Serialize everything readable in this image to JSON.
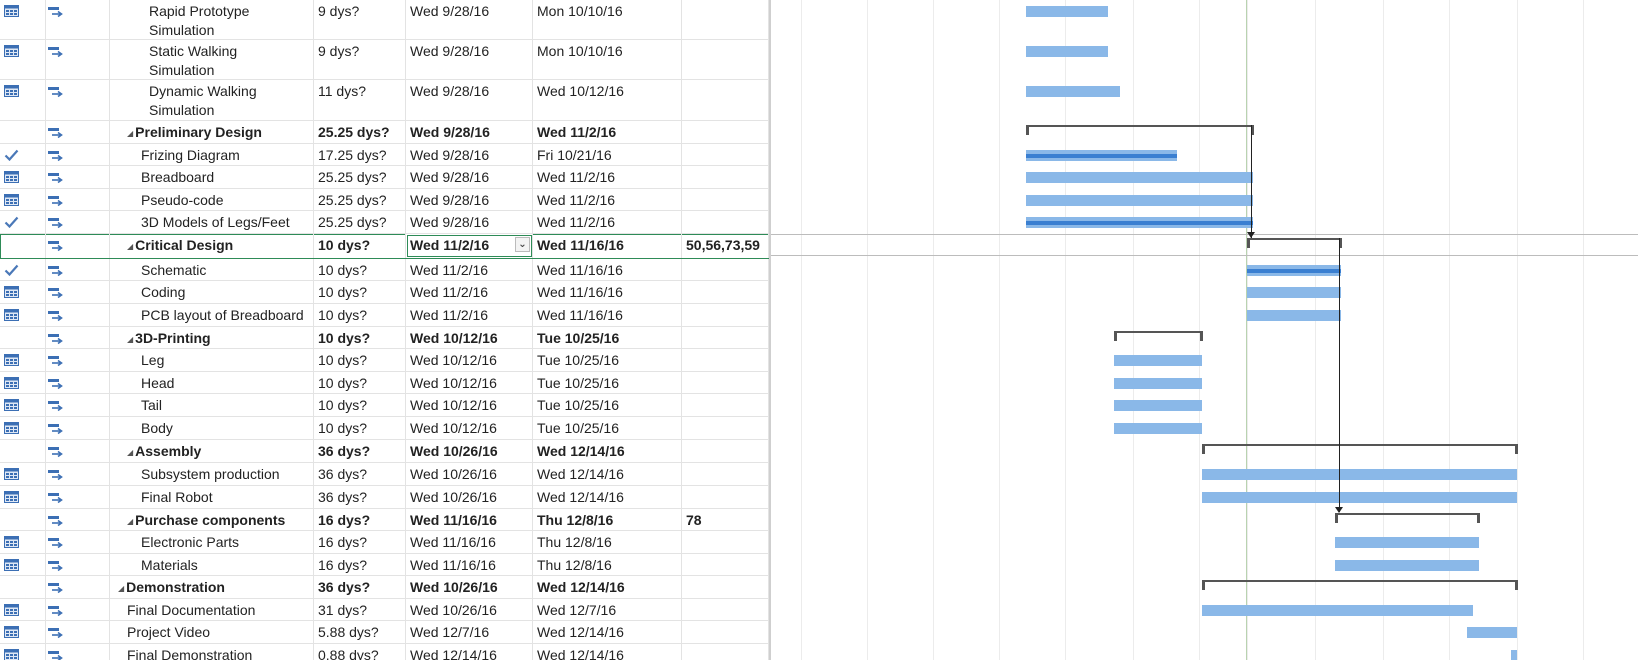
{
  "colors": {
    "bar": "#8ab8e8",
    "progress": "#3a7fd1",
    "summary": "#555555",
    "selection": "#2e8b57",
    "check": "#4a78b8"
  },
  "tasks": [
    {
      "indicator": "calendar-icon",
      "name": "Rapid Prototype",
      "name2": "Simulation",
      "duration": "9 dys?",
      "start": "Wed 9/28/16",
      "finish": "Mon 10/10/16",
      "pred": "",
      "level": 3,
      "bold": false
    },
    {
      "indicator": "calendar-icon",
      "name": "Static Walking",
      "name2": "Simulation",
      "duration": "9 dys?",
      "start": "Wed 9/28/16",
      "finish": "Mon 10/10/16",
      "pred": "",
      "level": 3,
      "bold": false
    },
    {
      "indicator": "calendar-icon",
      "name": "Dynamic Walking",
      "name2": "Simulation",
      "duration": "11 dys?",
      "start": "Wed 9/28/16",
      "finish": "Wed 10/12/16",
      "pred": "",
      "level": 3,
      "bold": false
    },
    {
      "indicator": "",
      "name": "Preliminary Design",
      "name2": "",
      "duration": "25.25 dys?",
      "start": "Wed 9/28/16",
      "finish": "Wed 11/2/16",
      "pred": "",
      "level": 1,
      "bold": true
    },
    {
      "indicator": "check-icon",
      "name": "Frizing Diagram",
      "name2": "",
      "duration": "17.25 dys?",
      "start": "Wed 9/28/16",
      "finish": "Fri 10/21/16",
      "pred": "",
      "level": 2,
      "bold": false
    },
    {
      "indicator": "calendar-icon",
      "name": "Breadboard",
      "name2": "",
      "duration": "25.25 dys?",
      "start": "Wed 9/28/16",
      "finish": "Wed 11/2/16",
      "pred": "",
      "level": 2,
      "bold": false
    },
    {
      "indicator": "calendar-icon",
      "name": "Pseudo-code",
      "name2": "",
      "duration": "25.25 dys?",
      "start": "Wed 9/28/16",
      "finish": "Wed 11/2/16",
      "pred": "",
      "level": 2,
      "bold": false
    },
    {
      "indicator": "check-icon",
      "name": "3D Models of Legs/Feet",
      "name2": "",
      "duration": "25.25 dys?",
      "start": "Wed 9/28/16",
      "finish": "Wed 11/2/16",
      "pred": "",
      "level": 2,
      "bold": false
    },
    {
      "indicator": "",
      "name": "Critical Design",
      "name2": "",
      "duration": "10 dys?",
      "start": "Wed 11/2/16",
      "finish": "Wed 11/16/16",
      "pred": "50,56,73,59",
      "level": 1,
      "bold": true
    },
    {
      "indicator": "check-icon",
      "name": "Schematic",
      "name2": "",
      "duration": "10 dys?",
      "start": "Wed 11/2/16",
      "finish": "Wed 11/16/16",
      "pred": "",
      "level": 2,
      "bold": false
    },
    {
      "indicator": "calendar-icon",
      "name": "Coding",
      "name2": "",
      "duration": "10 dys?",
      "start": "Wed 11/2/16",
      "finish": "Wed 11/16/16",
      "pred": "",
      "level": 2,
      "bold": false
    },
    {
      "indicator": "calendar-icon",
      "name": "PCB layout of Breadboard",
      "name2": "",
      "duration": "10 dys?",
      "start": "Wed 11/2/16",
      "finish": "Wed 11/16/16",
      "pred": "",
      "level": 2,
      "bold": false
    },
    {
      "indicator": "",
      "name": "3D-Printing",
      "name2": "",
      "duration": "10 dys?",
      "start": "Wed 10/12/16",
      "finish": "Tue 10/25/16",
      "pred": "",
      "level": 1,
      "bold": true
    },
    {
      "indicator": "calendar-icon",
      "name": "Leg",
      "name2": "",
      "duration": "10 dys?",
      "start": "Wed 10/12/16",
      "finish": "Tue 10/25/16",
      "pred": "",
      "level": 2,
      "bold": false
    },
    {
      "indicator": "calendar-icon",
      "name": "Head",
      "name2": "",
      "duration": "10 dys?",
      "start": "Wed 10/12/16",
      "finish": "Tue 10/25/16",
      "pred": "",
      "level": 2,
      "bold": false
    },
    {
      "indicator": "calendar-icon",
      "name": "Tail",
      "name2": "",
      "duration": "10 dys?",
      "start": "Wed 10/12/16",
      "finish": "Tue 10/25/16",
      "pred": "",
      "level": 2,
      "bold": false
    },
    {
      "indicator": "calendar-icon",
      "name": "Body",
      "name2": "",
      "duration": "10 dys?",
      "start": "Wed 10/12/16",
      "finish": "Tue 10/25/16",
      "pred": "",
      "level": 2,
      "bold": false
    },
    {
      "indicator": "",
      "name": "Assembly",
      "name2": "",
      "duration": "36 dys?",
      "start": "Wed 10/26/16",
      "finish": "Wed 12/14/16",
      "pred": "",
      "level": 1,
      "bold": true
    },
    {
      "indicator": "calendar-icon",
      "name": "Subsystem production",
      "name2": "",
      "duration": "36 dys?",
      "start": "Wed 10/26/16",
      "finish": "Wed 12/14/16",
      "pred": "",
      "level": 2,
      "bold": false
    },
    {
      "indicator": "calendar-icon",
      "name": "Final Robot",
      "name2": "",
      "duration": "36 dys?",
      "start": "Wed 10/26/16",
      "finish": "Wed 12/14/16",
      "pred": "",
      "level": 2,
      "bold": false
    },
    {
      "indicator": "",
      "name": "Purchase components",
      "name2": "",
      "duration": "16 dys?",
      "start": "Wed 11/16/16",
      "finish": "Thu 12/8/16",
      "pred": "78",
      "level": 1,
      "bold": true
    },
    {
      "indicator": "calendar-icon",
      "name": "Electronic Parts",
      "name2": "",
      "duration": "16 dys?",
      "start": "Wed 11/16/16",
      "finish": "Thu 12/8/16",
      "pred": "",
      "level": 2,
      "bold": false
    },
    {
      "indicator": "calendar-icon",
      "name": "Materials",
      "name2": "",
      "duration": "16 dys?",
      "start": "Wed 11/16/16",
      "finish": "Thu 12/8/16",
      "pred": "",
      "level": 2,
      "bold": false
    },
    {
      "indicator": "",
      "name": "Demonstration",
      "name2": "",
      "duration": "36 dys?",
      "start": "Wed 10/26/16",
      "finish": "Wed 12/14/16",
      "pred": "",
      "level": 0,
      "bold": true
    },
    {
      "indicator": "calendar-icon",
      "name": "Final Documentation",
      "name2": "",
      "duration": "31 dys?",
      "start": "Wed 10/26/16",
      "finish": "Wed 12/7/16",
      "pred": "",
      "level": 1,
      "bold": false
    },
    {
      "indicator": "calendar-icon",
      "name": "Project Video",
      "name2": "",
      "duration": "5.88 dys?",
      "start": "Wed 12/7/16",
      "finish": "Wed 12/14/16",
      "pred": "",
      "level": 1,
      "bold": false
    },
    {
      "indicator": "calendar-icon",
      "name": "Final Demonstration",
      "name2": "",
      "duration": "0.88 dys?",
      "start": "Wed 12/14/16",
      "finish": "Wed 12/14/16",
      "pred": "",
      "level": 1,
      "bold": false
    }
  ]
}
